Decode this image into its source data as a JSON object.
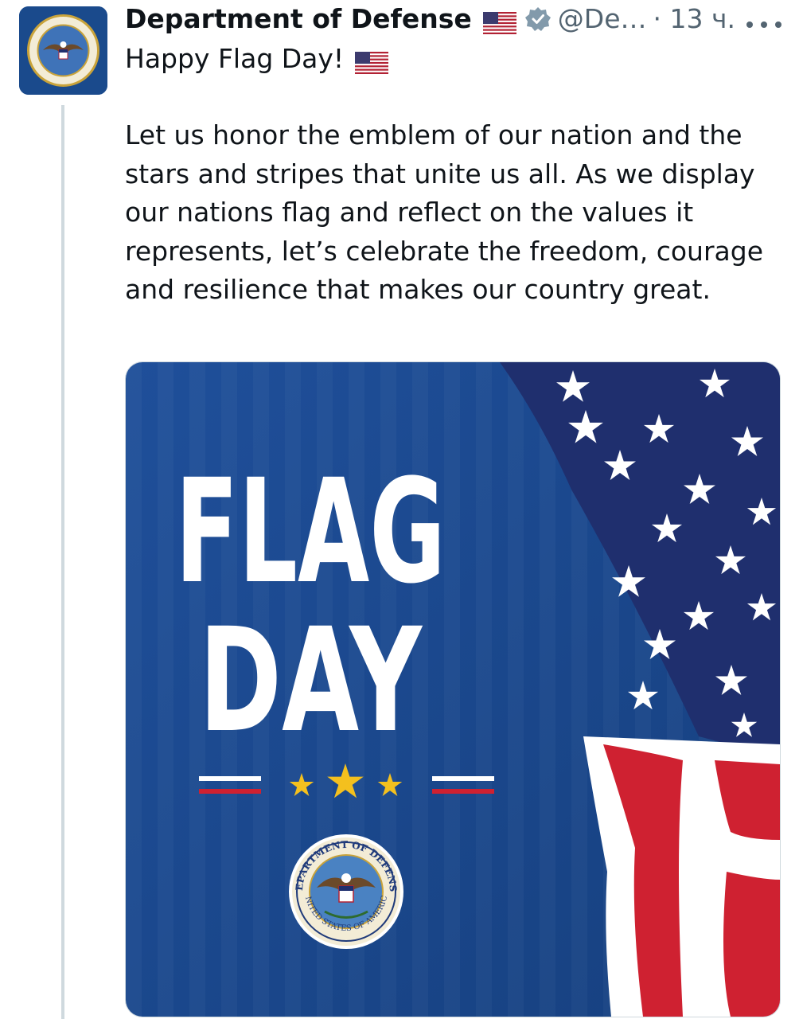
{
  "post": {
    "display_name": "Department of Defense",
    "handle": "@De…",
    "time": "· 13 ч.",
    "first_line": "Happy Flag Day!",
    "body": "Let us honor the emblem of our nation and the stars and stripes that unite us all. As we display our nations flag and reflect on the values it represents, let’s celebrate the freedom, courage and resilience that makes our country great.",
    "more_icon": "more-horizontal-icon",
    "verified_icon": "verified-badge-icon"
  },
  "media": {
    "headline_line1": "FLAG",
    "headline_line2": "DAY",
    "seal_top_text": "DEPARTMENT OF DEFENSE",
    "seal_bottom_text": "UNITED STATES OF AMERICA",
    "colors": {
      "background": "#1e4c96",
      "star_gold": "#f4c01e",
      "stripe_red": "#cf2131",
      "flag_blue": "#1f2f6e"
    }
  },
  "colors": {
    "text": "#0f1419",
    "muted": "#536471",
    "thread_line": "#cfd9de"
  }
}
